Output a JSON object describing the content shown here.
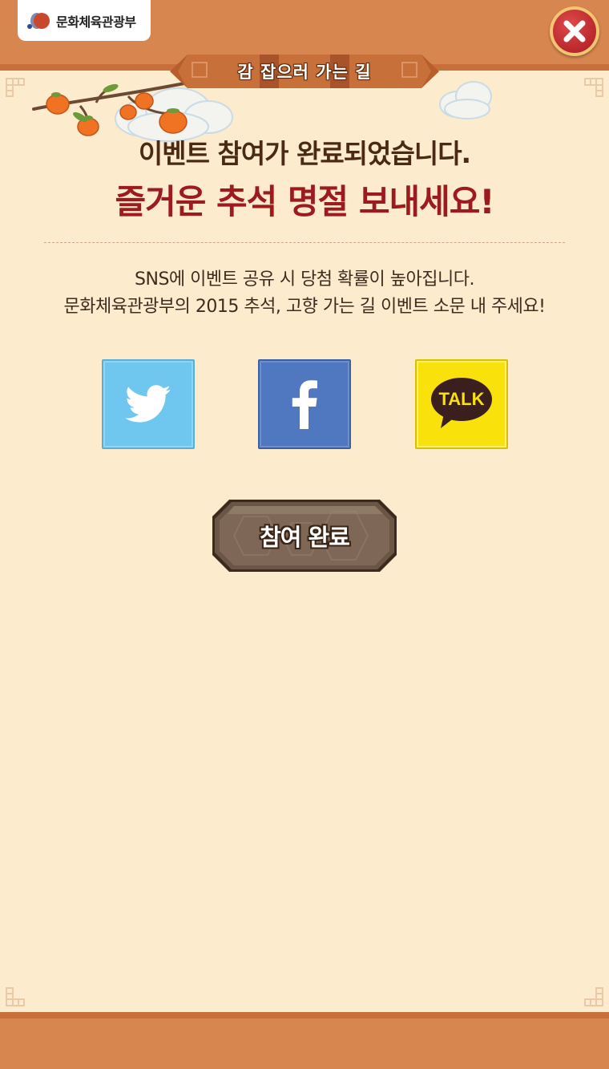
{
  "header": {
    "logo_text": "문화체육관광부",
    "close_icon": "close-x-icon"
  },
  "ribbon": {
    "title": "감 잡으러 가는 길"
  },
  "message": {
    "line1": "이벤트 참여가 완료되었습니다.",
    "line2": "즐거운 추석 명절 보내세요!",
    "description_1": "SNS에 이벤트 공유 시 당첨 확률이 높아집니다.",
    "description_2": "문화체육관광부의 2015 추석, 고향 가는 길 이벤트 소문 내 주세요!"
  },
  "share": {
    "twitter_icon": "twitter-bird-icon",
    "facebook_icon": "facebook-f-icon",
    "kakao_label": "TALK"
  },
  "actions": {
    "complete_label": "참여 완료"
  },
  "colors": {
    "frame": "#d8864f",
    "panel": "#fdebcd",
    "title_dark": "#4a2a14",
    "title_red": "#9b1b1f",
    "twitter": "#6fc6ee",
    "facebook": "#4f78c0",
    "kakao": "#f9e10b"
  }
}
